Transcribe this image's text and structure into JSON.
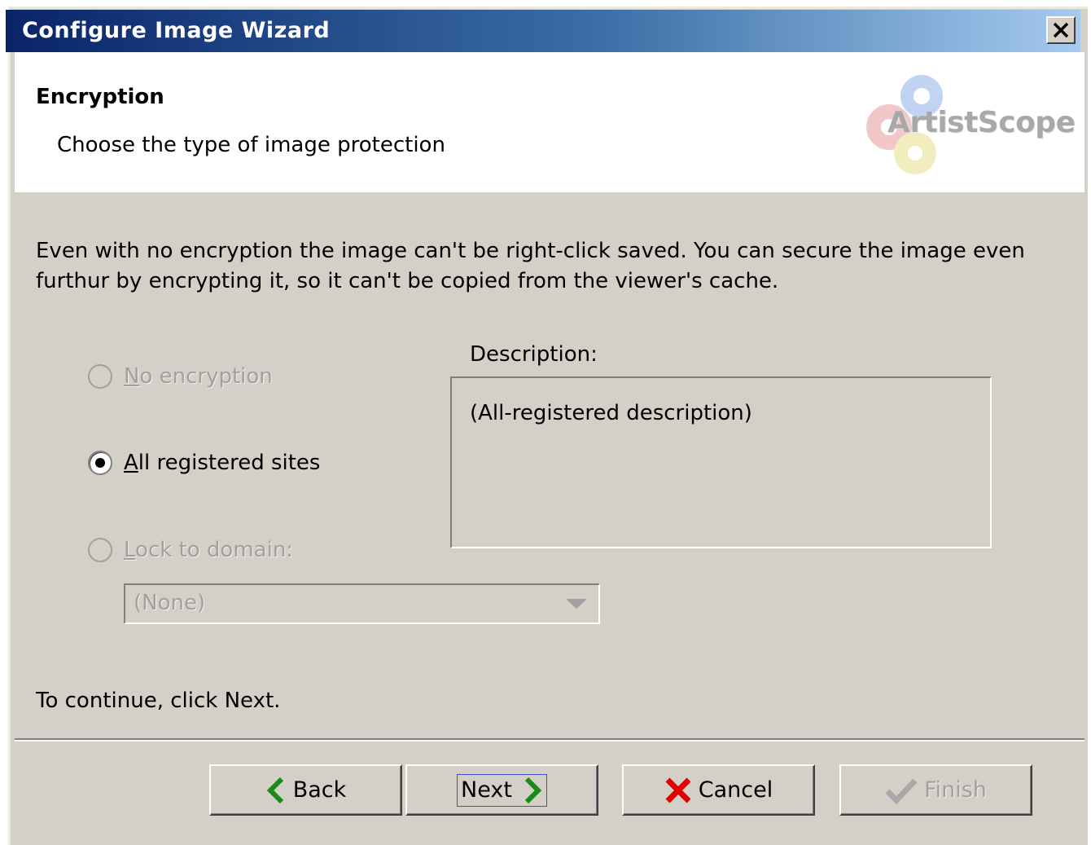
{
  "window": {
    "title": "Configure Image Wizard"
  },
  "header": {
    "step_title": "Encryption",
    "step_subtitle": "Choose the type of image protection",
    "logo_text": "ArtistScope"
  },
  "intro_text": "Even with no encryption the image can't be right-click saved. You can secure the image even furthur by encrypting it, so it can't be copied from the viewer's cache.",
  "options": [
    {
      "label_mnemonic": "N",
      "label_rest": "o encryption",
      "selected": false,
      "enabled": false
    },
    {
      "label_mnemonic": "A",
      "label_rest": "ll registered sites",
      "selected": true,
      "enabled": true
    },
    {
      "label_mnemonic": "L",
      "label_rest": "ock to domain:",
      "selected": false,
      "enabled": false
    }
  ],
  "domain_select": {
    "value": "(None)",
    "enabled": false
  },
  "description": {
    "label": "Description:",
    "text": "(All-registered description)"
  },
  "footer_text": "To continue, click Next.",
  "buttons": {
    "back": "Back",
    "next": "Next",
    "cancel": "Cancel",
    "finish": "Finish"
  },
  "colors": {
    "title_gradient_start": "#0a246a",
    "title_gradient_end": "#a6caf0",
    "dialog_face": "#d4d0c8",
    "nav_arrow_green": "#1a8a1a",
    "cancel_red": "#e00000",
    "disabled_text": "#a0a0a0"
  },
  "icons": {
    "back": "chevron-left-icon",
    "next": "chevron-right-icon",
    "cancel": "red-x-icon",
    "finish": "check-icon",
    "close": "close-icon"
  }
}
